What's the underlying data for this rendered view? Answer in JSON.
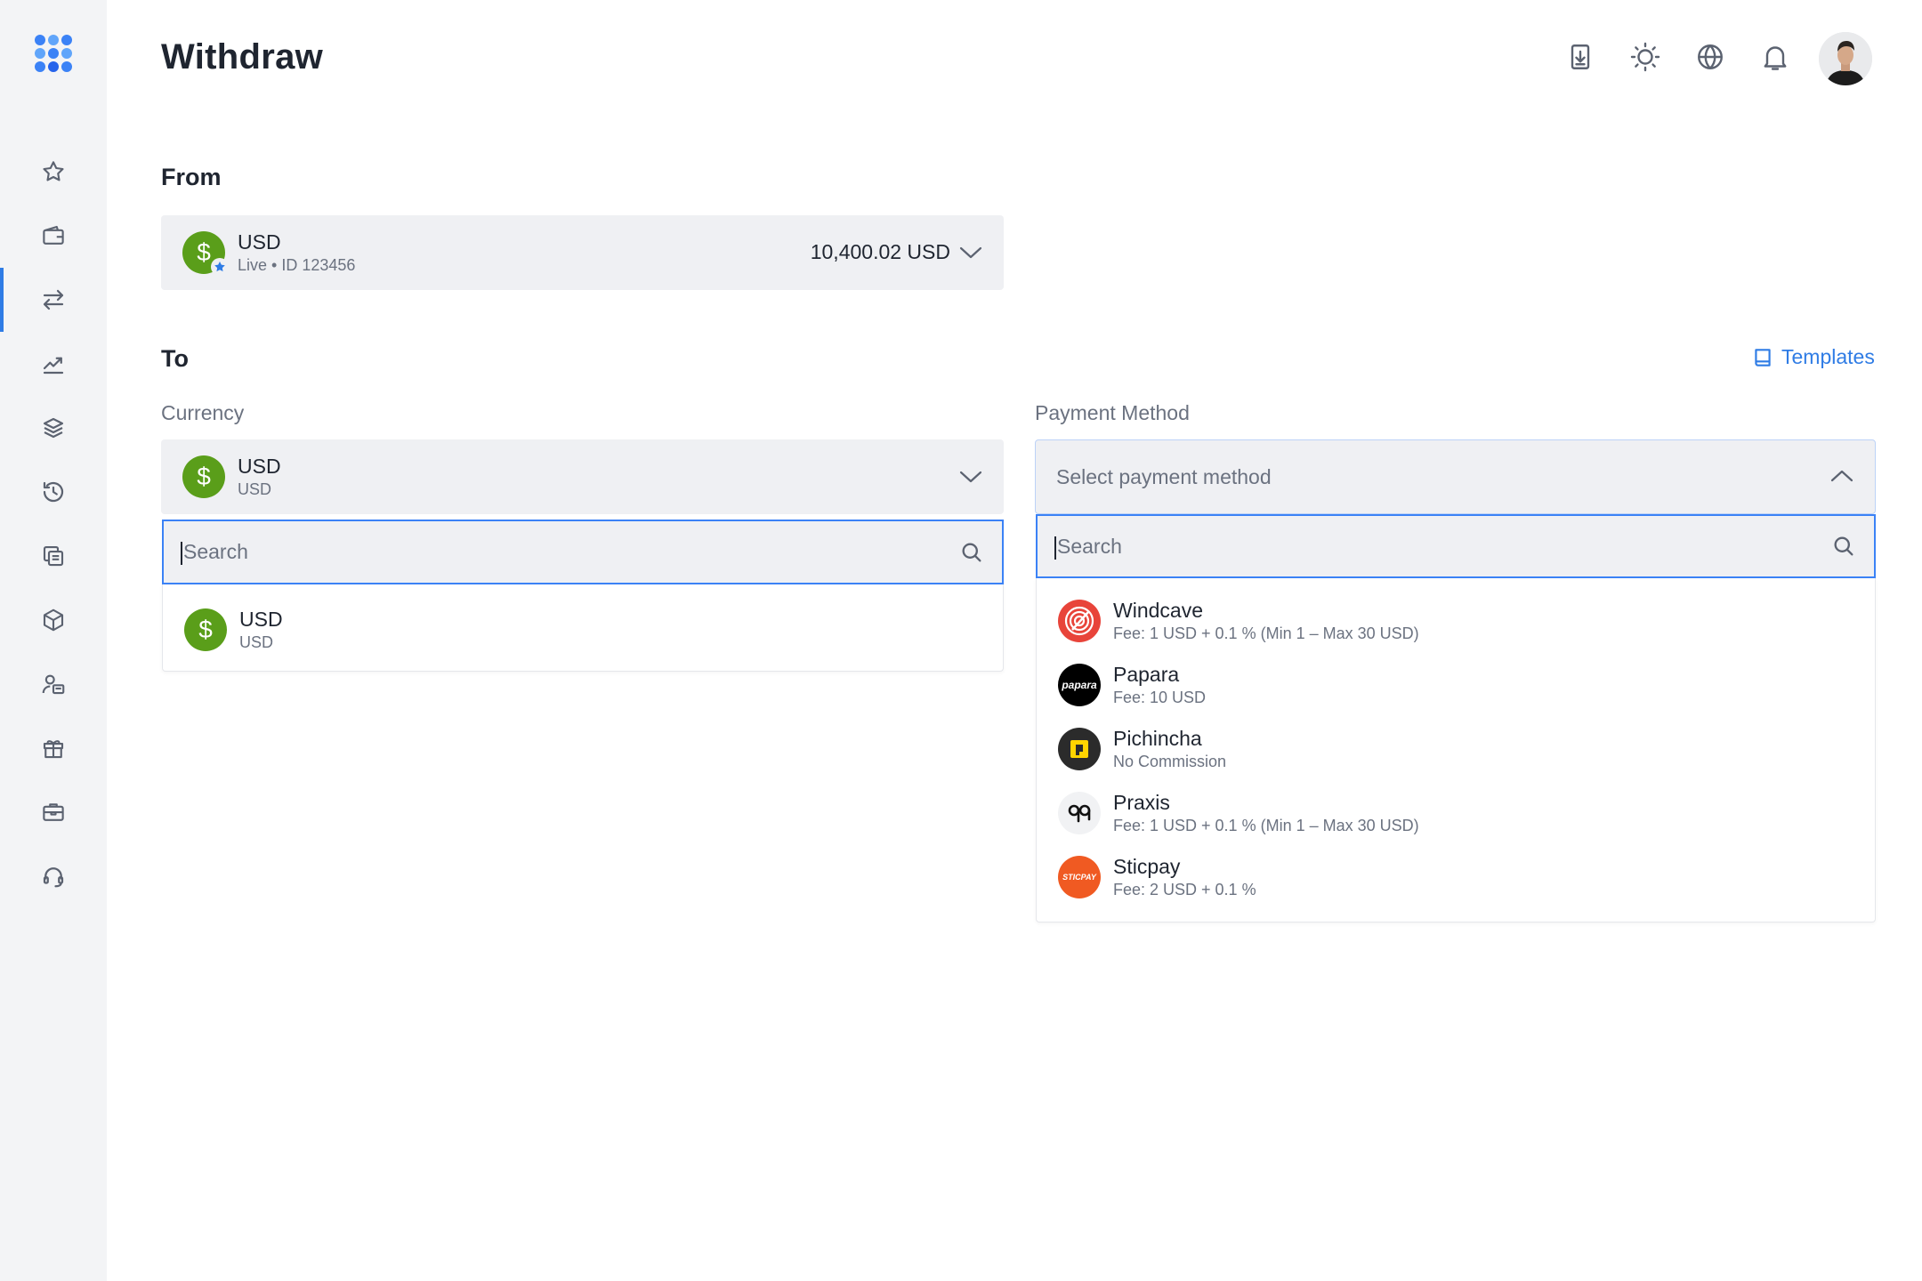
{
  "header": {
    "title": "Withdraw"
  },
  "sidebar": {
    "items": [
      {
        "icon": "star-icon"
      },
      {
        "icon": "wallet-icon"
      },
      {
        "icon": "transfer-icon",
        "active": true
      },
      {
        "icon": "trending-up-icon"
      },
      {
        "icon": "layers-icon"
      },
      {
        "icon": "history-icon"
      },
      {
        "icon": "copy-icon"
      },
      {
        "icon": "cube-icon"
      },
      {
        "icon": "users-icon"
      },
      {
        "icon": "gift-icon"
      },
      {
        "icon": "briefcase-icon"
      },
      {
        "icon": "headset-icon"
      }
    ]
  },
  "from": {
    "label": "From",
    "account_name": "USD",
    "account_sub": "Live • ID 123456",
    "balance": "10,400.02 USD",
    "coin_symbol": "$"
  },
  "to": {
    "label": "To",
    "templates_label": "Templates",
    "currency_label": "Currency",
    "currency_selected": "USD",
    "currency_selected_sub": "USD",
    "currency_search_placeholder": "Search",
    "currency_options": [
      {
        "name": "USD",
        "sub": "USD"
      }
    ],
    "payment_label": "Payment Method",
    "payment_placeholder": "Select payment method",
    "payment_search_placeholder": "Search",
    "payment_methods": [
      {
        "name": "Windcave",
        "fee": "Fee: 1 USD + 0.1 % (Min 1 – Max 30 USD)"
      },
      {
        "name": "Papara",
        "fee": "Fee: 10 USD",
        "logo_text": "papara"
      },
      {
        "name": "Pichincha",
        "fee": "No Commission"
      },
      {
        "name": "Praxis",
        "fee": "Fee: 1 USD + 0.1 % (Min 1 – Max 30 USD)"
      },
      {
        "name": "Sticpay",
        "fee": "Fee: 2 USD + 0.1 %",
        "logo_text": "STICPAY"
      }
    ]
  },
  "colors": {
    "accent": "#2f7ce5",
    "coin_green": "#5a9e1a",
    "windcave": "#e8443a",
    "papara": "#000000",
    "pichincha_bg": "#2b2b2b",
    "pichincha_yellow": "#ffd400",
    "sticpay": "#f05a22"
  }
}
